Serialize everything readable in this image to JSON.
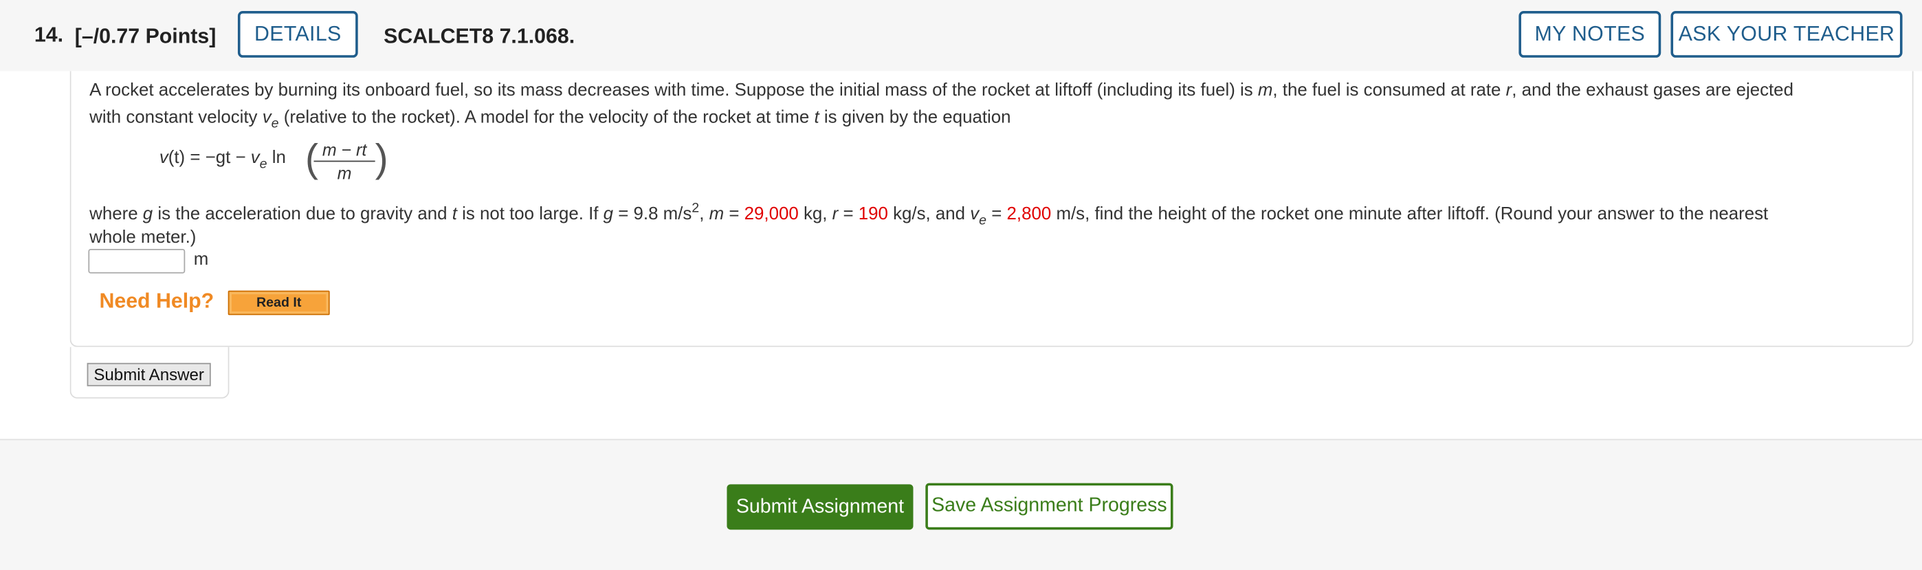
{
  "header": {
    "question_number": "14.",
    "points": "[–/0.77 Points]",
    "details_label": "DETAILS",
    "question_code": "SCALCET8 7.1.068.",
    "my_notes_label": "MY NOTES",
    "ask_teacher_label": "ASK YOUR TEACHER"
  },
  "problem": {
    "l1_a": "A rocket accelerates by burning its onboard fuel, so its mass decreases with time. Suppose the initial mass of the rocket at liftoff (including its fuel) is ",
    "l1_m": "m",
    "l1_b": ", the fuel is consumed at rate ",
    "l1_r": "r",
    "l1_c": ", and the exhaust gases are ejected",
    "l2_a": "with constant velocity ",
    "l2_v": "v",
    "l2_sub": "e",
    "l2_b": " (relative to the rocket). A model for the velocity of the rocket at time ",
    "l2_t": "t",
    "l2_c": " is given by the equation",
    "eq_lhs_v": "v",
    "eq_lhs_rest": "(t) = −gt − ",
    "eq_ve": "v",
    "eq_ve_sub": "e",
    "eq_ln": " ln",
    "eq_num": "m − rt",
    "eq_den": "m",
    "l3_a": "where ",
    "l3_g": "g",
    "l3_b": " is the acceleration due to gravity and ",
    "l3_t": "t",
    "l3_c": " is not too large. If ",
    "l3_g2": "g",
    "l3_d": " = 9.8 m/s",
    "l3_sup": "2",
    "l3_e": ", ",
    "l3_m": "m",
    "l3_f": " = ",
    "mass_value": "29,000",
    "l3_g3": " kg, ",
    "l3_r": "r",
    "l3_h": " = ",
    "rate_value": "190",
    "l3_i": " kg/s, and ",
    "l3_v": "v",
    "l3_vsub": "e",
    "l3_j": " = ",
    "ve_value": "2,800",
    "l3_k": " m/s, find the height of the rocket one minute after liftoff. (Round your answer to the nearest",
    "l4": "whole meter.)"
  },
  "answer": {
    "value": "",
    "unit": "m"
  },
  "help": {
    "need_help_label": "Need Help?",
    "read_it_label": "Read It"
  },
  "submit_answer_label": "Submit Answer",
  "footer": {
    "submit_assignment_label": "Submit Assignment",
    "save_progress_label": "Save Assignment Progress"
  },
  "colors": {
    "accent_blue": "#1f5d8c",
    "given_value_red": "#e00000",
    "help_orange": "#f08a24",
    "green": "#3a7d1a"
  }
}
